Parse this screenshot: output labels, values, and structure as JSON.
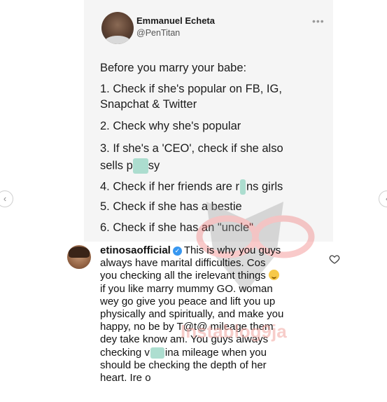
{
  "tweet": {
    "author_name": "Emmanuel Echeta",
    "author_handle": "@PenTitan",
    "more_icon": "ellipsis-icon",
    "heading": "Before you marry your babe:",
    "lines": [
      "1. Check if she's popular on FB, IG,",
      "Snapchat & Twitter",
      "2. Check why she's popular",
      "3. If she's a 'CEO', check if she also",
      "sells p",
      "sy",
      "4. Check if her friends are r",
      "ns girls",
      "5. Check if she has a bestie",
      "6. Check if she has an \"uncle\""
    ]
  },
  "comment": {
    "username": "etinosaofficial",
    "verified_icon": "verified-badge-icon",
    "lines": [
      "This is why you guys",
      "always have marital difficulties. Cos",
      "you checking all the irelevant things",
      "if you like marry mummy GO. woman",
      "wey go give you peace and lift you up",
      "physically and spiritually, and make you",
      "happy, no be by T@t@ mileage them",
      "dey take know am. You guys always",
      "checking v",
      "ina mileage when you",
      "should be checking the depth of her",
      "heart. Ire o"
    ],
    "heart_icon": "heart-outline-icon"
  },
  "watermark": {
    "text": "Instablog9ja"
  },
  "nav": {
    "prev_icon": "chevron-left-icon",
    "next_icon": "chevron-right-icon",
    "prev": "‹",
    "next": "‹"
  },
  "colors": {
    "card_bg": "#f5f5f5",
    "verified": "#3897f0",
    "watermark": "#f2a6a0"
  }
}
